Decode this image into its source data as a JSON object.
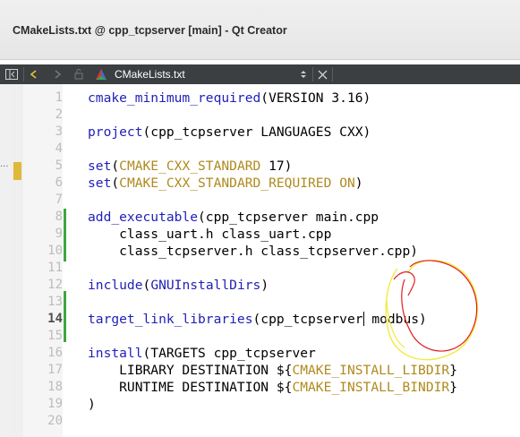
{
  "window": {
    "title": "CMakeLists.txt @ cpp_tcpserver [main] - Qt Creator"
  },
  "toolbar": {
    "sidebar_toggle_icon": "sidebar-toggle-icon",
    "back_icon": "back-arrow-icon",
    "forward_icon": "forward-arrow-icon",
    "lock_icon": "lock-icon",
    "file_icon": "cmake-file-icon",
    "file_name": "CMakeLists.txt",
    "dropdown_icon": "dropdown-arrows-icon",
    "close_icon": "close-icon"
  },
  "sidebar": {
    "dots": "..."
  },
  "editor": {
    "current_line": 14,
    "lines": [
      {
        "num": "1",
        "tokens": [
          {
            "t": "cmake_minimum_required",
            "c": "fn"
          },
          {
            "t": "(VERSION 3.16)",
            "c": "plain"
          }
        ]
      },
      {
        "num": "2",
        "tokens": []
      },
      {
        "num": "3",
        "tokens": [
          {
            "t": "project",
            "c": "fn"
          },
          {
            "t": "(cpp_tcpserver LANGUAGES CXX)",
            "c": "plain"
          }
        ]
      },
      {
        "num": "4",
        "tokens": []
      },
      {
        "num": "5",
        "tokens": [
          {
            "t": "set",
            "c": "fn"
          },
          {
            "t": "(",
            "c": "plain"
          },
          {
            "t": "CMAKE_CXX_STANDARD",
            "c": "var"
          },
          {
            "t": " 17)",
            "c": "plain"
          }
        ]
      },
      {
        "num": "6",
        "tokens": [
          {
            "t": "set",
            "c": "fn"
          },
          {
            "t": "(",
            "c": "plain"
          },
          {
            "t": "CMAKE_CXX_STANDARD_REQUIRED",
            "c": "var"
          },
          {
            "t": " ",
            "c": "plain"
          },
          {
            "t": "ON",
            "c": "var"
          },
          {
            "t": ")",
            "c": "plain"
          }
        ]
      },
      {
        "num": "7",
        "tokens": []
      },
      {
        "num": "8",
        "tokens": [
          {
            "t": "add_executable",
            "c": "fn"
          },
          {
            "t": "(cpp_tcpserver main.cpp",
            "c": "plain"
          }
        ]
      },
      {
        "num": "9",
        "tokens": [
          {
            "t": "    class_uart.h class_uart.cpp",
            "c": "plain"
          }
        ]
      },
      {
        "num": "10",
        "tokens": [
          {
            "t": "    class_tcpserver.h class_tcpserver.cpp)",
            "c": "plain"
          }
        ]
      },
      {
        "num": "11",
        "tokens": []
      },
      {
        "num": "12",
        "tokens": [
          {
            "t": "include",
            "c": "fn"
          },
          {
            "t": "(",
            "c": "plain"
          },
          {
            "t": "GNUInstallDirs",
            "c": "fn"
          },
          {
            "t": ")",
            "c": "plain"
          }
        ]
      },
      {
        "num": "13",
        "tokens": []
      },
      {
        "num": "14",
        "tokens": [
          {
            "t": "target_link_libraries",
            "c": "fn"
          },
          {
            "t": "(cpp_tcpserver",
            "c": "plain"
          },
          {
            "t": "",
            "c": "cursor"
          },
          {
            "t": " modbus)",
            "c": "plain"
          }
        ]
      },
      {
        "num": "15",
        "tokens": []
      },
      {
        "num": "16",
        "tokens": [
          {
            "t": "install",
            "c": "fn"
          },
          {
            "t": "(TARGETS cpp_tcpserver",
            "c": "plain"
          }
        ]
      },
      {
        "num": "17",
        "tokens": [
          {
            "t": "    LIBRARY DESTINATION ${",
            "c": "plain"
          },
          {
            "t": "CMAKE_INSTALL_LIBDIR",
            "c": "var"
          },
          {
            "t": "}",
            "c": "plain"
          }
        ]
      },
      {
        "num": "18",
        "tokens": [
          {
            "t": "    RUNTIME DESTINATION ${",
            "c": "plain"
          },
          {
            "t": "CMAKE_INSTALL_BINDIR",
            "c": "var"
          },
          {
            "t": "}",
            "c": "plain"
          }
        ]
      },
      {
        "num": "19",
        "tokens": [
          {
            "t": ")",
            "c": "plain"
          }
        ]
      },
      {
        "num": "20",
        "tokens": []
      }
    ]
  },
  "colors": {
    "function": "#1f1fb8",
    "variable": "#b08a1e",
    "change_marker": "#3ea63e",
    "bookmark_marker": "#e0b83a",
    "annotation_red": "#e02020",
    "annotation_yellow": "#f2ea3c"
  }
}
